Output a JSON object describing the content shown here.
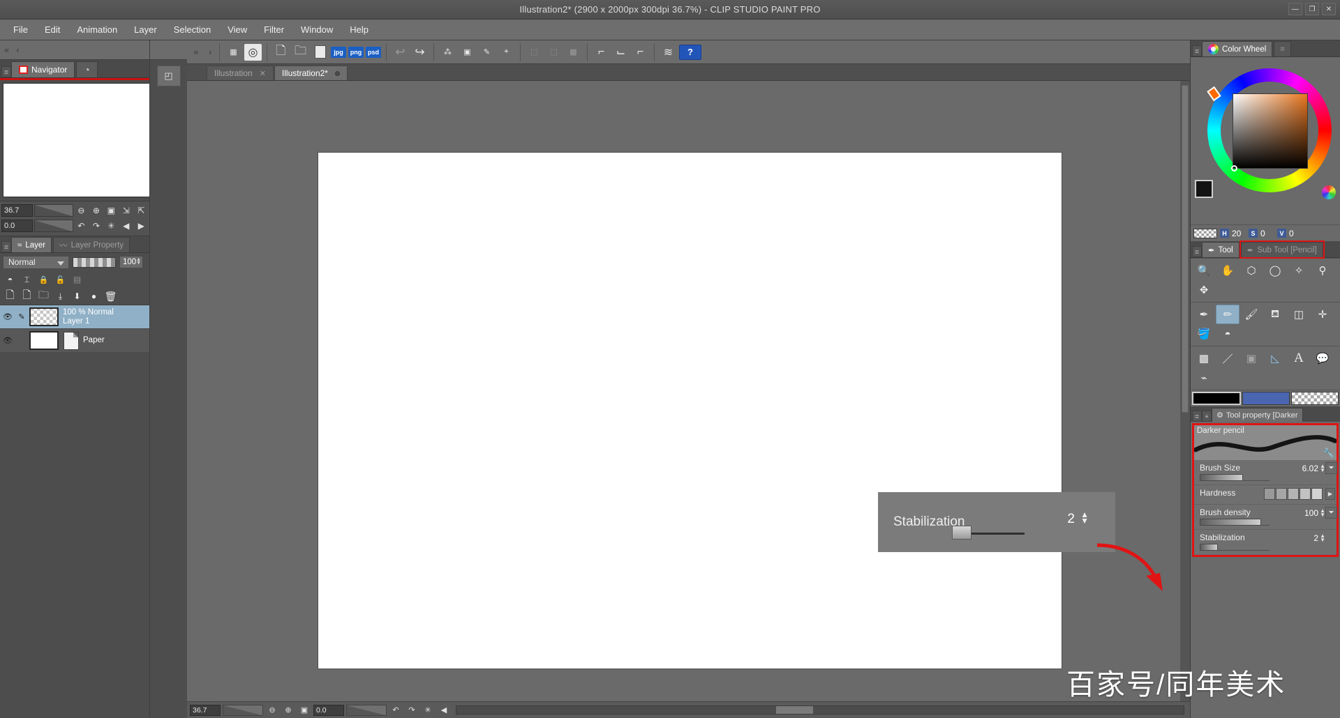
{
  "window": {
    "title": "Illustration2* (2900 x 2000px 300dpi 36.7%)  - CLIP STUDIO PAINT PRO",
    "minimize": "—",
    "maximize": "❐",
    "close": "✕"
  },
  "menubar": {
    "items": [
      "File",
      "Edit",
      "Animation",
      "Layer",
      "Selection",
      "View",
      "Filter",
      "Window",
      "Help"
    ]
  },
  "command_bar": {
    "nav_prev": "«",
    "nav_next": "›",
    "icons": [
      {
        "name": "grid-layout-icon",
        "glyph": "▦"
      },
      {
        "name": "clip-studio-icon",
        "glyph": "◎"
      },
      {
        "name": "new-file-icon",
        "glyph": "🗋"
      },
      {
        "name": "open-file-icon",
        "glyph": "🗀"
      },
      {
        "name": "save-icon",
        "glyph": "▯"
      }
    ],
    "export_formats": [
      "jpg",
      "png",
      "psd"
    ],
    "undo_label": "↩",
    "redo_label": "↪",
    "tool_icons": [
      {
        "name": "deselect-icon",
        "glyph": "⁂"
      },
      {
        "name": "fill-selection-icon",
        "glyph": "▣"
      },
      {
        "name": "paint-selection-icon",
        "glyph": "✎"
      },
      {
        "name": "transform-icon",
        "glyph": "⌖"
      },
      {
        "name": "clear-icon",
        "glyph": "⬚"
      },
      {
        "name": "invert-icon",
        "glyph": "⬚"
      },
      {
        "name": "ruler-grid-icon",
        "glyph": "▩"
      }
    ],
    "right_icons": [
      {
        "name": "frame-divider-icon",
        "glyph": "⌐"
      },
      {
        "name": "panel-split-icon",
        "glyph": "⌙"
      },
      {
        "name": "ruler-icon",
        "glyph": "⌐"
      },
      {
        "name": "layer-stack-icon",
        "glyph": "≋"
      }
    ],
    "help_label": "?"
  },
  "left_dock": {
    "topbar": {
      "collapse": "«",
      "back": "‹",
      "grip": "|||"
    },
    "navigator": {
      "tab_label": "Navigator",
      "menu_icon": "≣",
      "extra_tab_icon": "◔"
    },
    "nav_controls": {
      "zoom_value": "36.7",
      "rotate_value": "0.0",
      "buttons": [
        {
          "name": "zoom-out-button",
          "glyph": "⊖"
        },
        {
          "name": "zoom-in-button",
          "glyph": "⊕"
        },
        {
          "name": "fit-screen-button",
          "glyph": "▣"
        },
        {
          "name": "flip-horizontal-button",
          "glyph": "⇲"
        },
        {
          "name": "flip-vertical-button",
          "glyph": "⇱"
        },
        {
          "name": "rotate-left-button",
          "glyph": "↶"
        },
        {
          "name": "rotate-right-button",
          "glyph": "↷"
        },
        {
          "name": "reset-rotate-button",
          "glyph": "✳"
        },
        {
          "name": "nav-prev-button",
          "glyph": "◀"
        },
        {
          "name": "nav-next-button",
          "glyph": "▶"
        },
        {
          "name": "nav-up-button",
          "glyph": "▲"
        }
      ]
    },
    "layer_panel": {
      "tabs": [
        {
          "label": "Layer",
          "selected": true,
          "icon": "≈"
        },
        {
          "label": "Layer Property",
          "selected": false,
          "icon": "〰"
        }
      ],
      "blend_mode": "Normal",
      "opacity": "100",
      "action_icons": [
        {
          "name": "layer-mask-icon",
          "glyph": "◓"
        },
        {
          "name": "clipping-icon",
          "glyph": "⌶"
        },
        {
          "name": "lock-layer-icon",
          "glyph": "🔒"
        },
        {
          "name": "lock-transparency-icon",
          "glyph": "🔓"
        },
        {
          "name": "ruler-effect-icon",
          "glyph": "▤"
        },
        {
          "name": "new-raster-layer-icon",
          "glyph": "🗋"
        },
        {
          "name": "new-vector-layer-icon",
          "glyph": "🗋"
        },
        {
          "name": "new-folder-icon",
          "glyph": "🗀"
        },
        {
          "name": "transfer-down-icon",
          "glyph": "⤓"
        },
        {
          "name": "merge-down-icon",
          "glyph": "⬇"
        },
        {
          "name": "mask-circle-icon",
          "glyph": "●"
        },
        {
          "name": "delete-layer-icon",
          "glyph": "🗑"
        }
      ],
      "layers": [
        {
          "name": "Layer 1",
          "info": "100 % Normal",
          "visible": true,
          "selected": true,
          "thumb": "alpha"
        },
        {
          "name": "Paper",
          "info": "",
          "visible": true,
          "selected": false,
          "thumb": "white"
        }
      ]
    },
    "rail": {
      "sub_icon": "◰"
    }
  },
  "canvas": {
    "tabs": [
      {
        "label": "Illustration",
        "selected": false,
        "close": "✕"
      },
      {
        "label": "Illustration2*",
        "selected": true,
        "close": "●"
      }
    ],
    "status": {
      "zoom": "36.7",
      "rotate": "0.0",
      "buttons": [
        {
          "name": "status-zoom-out-button",
          "glyph": "⊖"
        },
        {
          "name": "status-zoom-in-button",
          "glyph": "⊕"
        },
        {
          "name": "status-fit-button",
          "glyph": "▣"
        },
        {
          "name": "status-rotate-left-button",
          "glyph": "↶"
        },
        {
          "name": "status-rotate-right-button",
          "glyph": "↷"
        },
        {
          "name": "status-reset-button",
          "glyph": "✳"
        },
        {
          "name": "status-prev-button",
          "glyph": "◀"
        }
      ]
    }
  },
  "right_dock": {
    "color_wheel": {
      "tab_label": "Color Wheel",
      "menu_icon": "≣",
      "list_icon": "≡",
      "hsv": [
        {
          "tag": "H",
          "value": "20"
        },
        {
          "tag": "S",
          "value": "0"
        },
        {
          "tag": "V",
          "value": "0"
        }
      ]
    },
    "tool_tabs": [
      {
        "label": "Tool",
        "selected": true,
        "icon": "✒"
      },
      {
        "label": "Sub Tool [Pencil]",
        "selected": false,
        "icon": "✒"
      }
    ],
    "tools": [
      [
        {
          "name": "magnifier-tool",
          "glyph": "🔍",
          "selected": false
        },
        {
          "name": "move-hand-tool",
          "glyph": "✋",
          "selected": false
        },
        {
          "name": "rotate-canvas-tool",
          "glyph": "⬡",
          "selected": false
        },
        {
          "name": "lasso-select-tool",
          "glyph": "◯",
          "selected": false
        },
        {
          "name": "auto-select-tool",
          "glyph": "✧",
          "selected": false
        },
        {
          "name": "eyedropper-tool",
          "glyph": "⚲",
          "selected": false
        },
        {
          "name": "move-layer-tool",
          "glyph": "✥",
          "selected": false
        }
      ],
      [
        {
          "name": "pen-tool",
          "glyph": "✒",
          "selected": false
        },
        {
          "name": "pencil-tool",
          "glyph": "✏",
          "selected": true
        },
        {
          "name": "brush-tool",
          "glyph": "🖌",
          "selected": false
        },
        {
          "name": "airbrush-tool",
          "glyph": "⛾",
          "selected": false
        },
        {
          "name": "eraser-tool",
          "glyph": "◫",
          "selected": false
        },
        {
          "name": "blend-tool",
          "glyph": "✛",
          "selected": false
        },
        {
          "name": "fill-tool",
          "glyph": "🪣",
          "selected": false
        },
        {
          "name": "gradient-blob-tool",
          "glyph": "◓",
          "selected": false
        }
      ],
      [
        {
          "name": "gradient-tool",
          "glyph": "▩",
          "selected": false
        },
        {
          "name": "line-figure-tool",
          "glyph": "／",
          "selected": false
        },
        {
          "name": "frame-border-tool",
          "glyph": "▣",
          "selected": false,
          "dim": true
        },
        {
          "name": "ruler-tool",
          "glyph": "◺",
          "selected": false
        },
        {
          "name": "text-tool",
          "glyph": "A",
          "selected": false
        },
        {
          "name": "balloon-tool",
          "glyph": "💬",
          "selected": false
        },
        {
          "name": "decoration-tool",
          "glyph": "⌁",
          "selected": false
        }
      ]
    ],
    "color_bar": {
      "main": "#000000",
      "sub": "#4a66b0",
      "transparent": "transparent"
    },
    "tool_property": {
      "tab_label": "Tool property [Darker",
      "menu_icon": "≣",
      "gear_icon": "⚙",
      "brush_name": "Darker pencil",
      "wrench_icon": "🔧",
      "rows": [
        {
          "label": "Brush Size",
          "value": "6.02",
          "slider_pct": 62,
          "has_lock": true,
          "type": "slider"
        },
        {
          "label": "Hardness",
          "value": "",
          "type": "hardness",
          "cells": 5
        },
        {
          "label": "Brush density",
          "value": "100",
          "slider_pct": 88,
          "has_lock": true,
          "type": "slider"
        },
        {
          "label": "Stabilization",
          "value": "2",
          "slider_pct": 26,
          "has_lock": false,
          "type": "slider"
        }
      ]
    }
  },
  "overlays": {
    "stabilization_popup": {
      "label": "Stabilization",
      "value": "2",
      "slider_pct": 12
    },
    "watermark": "百家号/同年美术",
    "arrow_color": "#e01414",
    "highlight_color": "#e01414"
  }
}
